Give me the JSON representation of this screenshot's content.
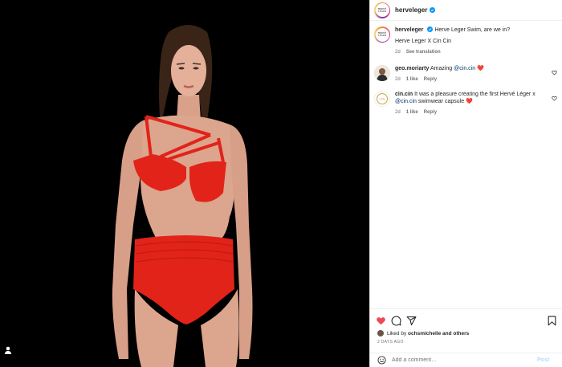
{
  "post": {
    "author": {
      "username": "herveleger",
      "verified": true,
      "avatar_logo_text": "HERVÉ LÉGER"
    },
    "caption": {
      "username": "herveleger",
      "text": "Herve Leger Swim, are we in?",
      "text2": "Herve Leger X Cin Cin",
      "age": "2d",
      "see_translation": "See translation"
    },
    "comments": [
      {
        "username": "geo.moriarty",
        "text": "Amazing",
        "mention": "@cin.cin",
        "emoji": "❤️",
        "age": "2d",
        "likes": "1 like",
        "reply": "Reply"
      },
      {
        "username": "cin.cin",
        "text": "It was a pleasure creating the first Hervé Léger x",
        "mention": "@cin.cin",
        "text_after": "swimwear capsule",
        "emoji": "❤️",
        "age": "2d",
        "likes": "1 like",
        "reply": "Reply",
        "avatar_logo_text": "CIN"
      }
    ],
    "liked_by": {
      "prefix": "Liked by",
      "user": "ochsmichelle",
      "suffix": "and others"
    },
    "timestamp": "2 DAYS AGO",
    "add_comment": {
      "placeholder": "Add a comment…",
      "post_label": "Post"
    },
    "icons": {
      "like": "heart-filled-icon",
      "comment": "comment-icon",
      "share": "share-icon",
      "save": "bookmark-icon",
      "emoji": "emoji-icon",
      "tagged_user": "user-tag-icon"
    },
    "colors": {
      "like_red": "#ed4956",
      "link_blue": "#00376b",
      "verified_blue": "#0095f6",
      "post_button_disabled": "#b3dbff"
    }
  }
}
